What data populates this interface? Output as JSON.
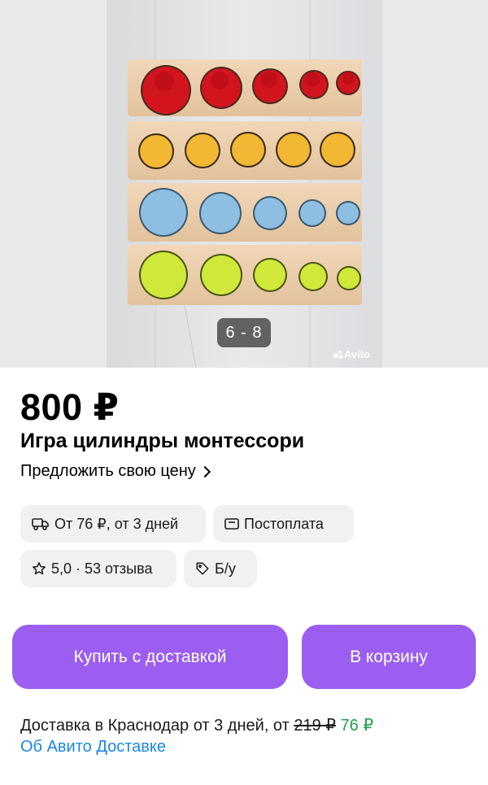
{
  "gallery": {
    "counter": "6 - 8",
    "watermark": "Avito"
  },
  "listing": {
    "price": "800 ₽",
    "title": "Игра цилиндры монтессори",
    "offer_link": "Предложить свою цену"
  },
  "chips": {
    "delivery": "От 76 ₽, от 3 дней",
    "postpay": "Постоплата",
    "rating": "5,0 · 53 отзыва",
    "condition": "Б/у"
  },
  "actions": {
    "buy_label": "Купить с доставкой",
    "cart_label": "В корзину"
  },
  "delivery_info": {
    "text": "Доставка в Краснодар от 3 дней, от ",
    "old_price": "219 ₽",
    "new_price": "76 ₽",
    "about_link": "Об Авито Доставке"
  },
  "colors": {
    "accent": "#9b5ef0",
    "link": "#1a87e6",
    "discount": "#1fa34a",
    "chip_bg": "#f2f1f0"
  },
  "icons": [
    "truck-icon",
    "wallet-icon",
    "star-icon",
    "tag-icon",
    "chevron-right-icon"
  ]
}
